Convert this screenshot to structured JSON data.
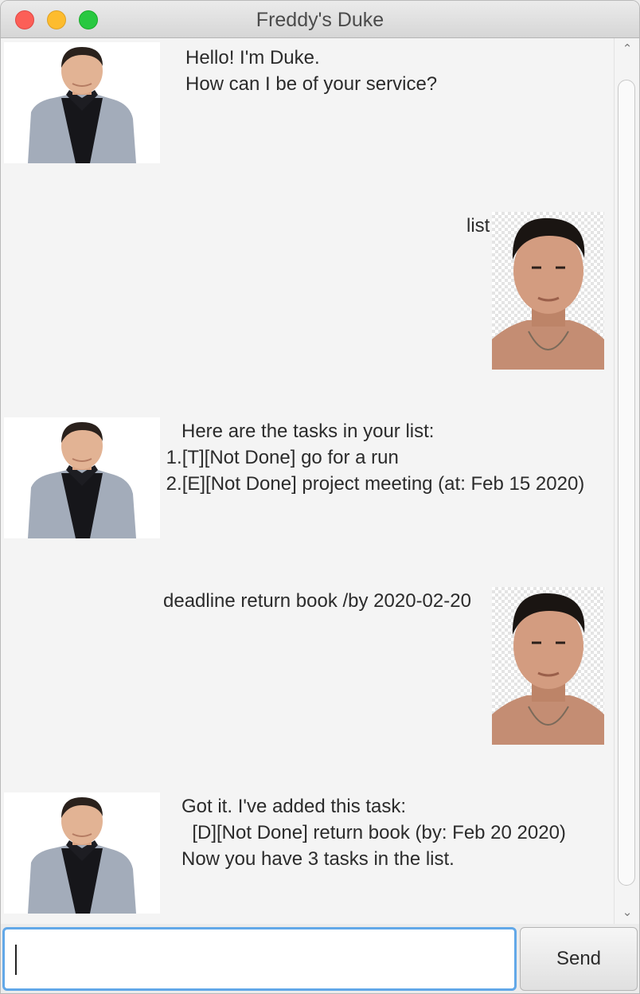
{
  "window": {
    "title": "Freddy's Duke"
  },
  "messages": [
    {
      "sender": "duke",
      "text": "Hello! I'm Duke.\nHow can I be of your service?"
    },
    {
      "sender": "user",
      "text": "list"
    },
    {
      "sender": "duke",
      "text": "Here are the tasks in your list:\n 1.[T][Not Done] go for a run\n 2.[E][Not Done] project meeting (at: Feb 15 2020)"
    },
    {
      "sender": "user",
      "text": "deadline return book /by 2020-02-20"
    },
    {
      "sender": "duke",
      "text": "Got it. I've added this task:\n  [D][Not Done] return book (by: Feb 20 2020)\nNow you have 3 tasks in the list."
    }
  ],
  "input": {
    "value": "",
    "placeholder": ""
  },
  "send_button": {
    "label": "Send"
  },
  "icons": {
    "scroll_up": "chevron-up-icon",
    "scroll_down": "chevron-down-icon"
  },
  "colors": {
    "close": "#fc5f57",
    "minimize": "#fdbc2e",
    "maximize": "#28c840",
    "input_focus": "#62a8e8"
  }
}
